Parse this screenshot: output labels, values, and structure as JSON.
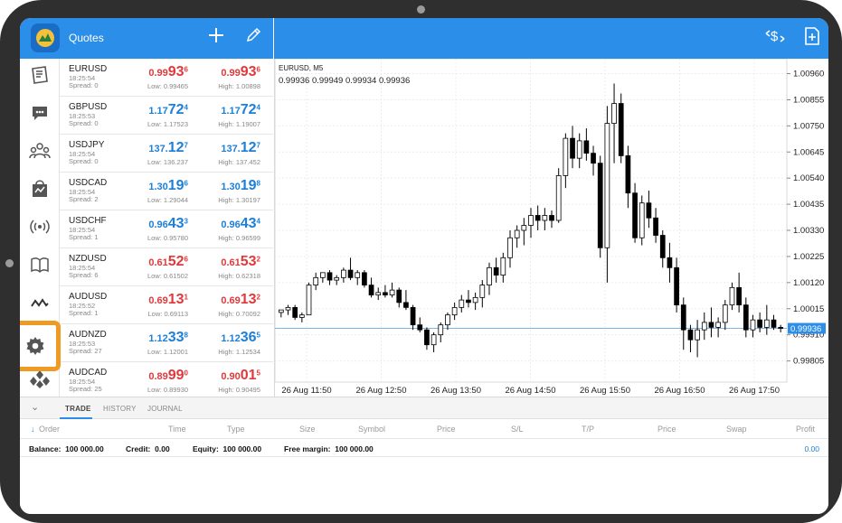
{
  "app": {
    "title": "Quotes"
  },
  "colors": {
    "accent": "#2b8ee8",
    "bid_down": "#e0393b",
    "bid_up": "#1c7fd8",
    "highlight": "#ef9a22"
  },
  "quotes": [
    {
      "symbol": "EURUSD",
      "time": "18:25:54",
      "spread": "Spread: 0",
      "dir": "red",
      "bid_pre": "0.99",
      "bid_big": "93",
      "bid_sup": "6",
      "ask_pre": "0.99",
      "ask_big": "93",
      "ask_sup": "6",
      "low": "Low: 0.99465",
      "high": "High: 1.00898"
    },
    {
      "symbol": "GBPUSD",
      "time": "18:25:53",
      "spread": "Spread: 0",
      "dir": "blue",
      "bid_pre": "1.17",
      "bid_big": "72",
      "bid_sup": "4",
      "ask_pre": "1.17",
      "ask_big": "72",
      "ask_sup": "4",
      "low": "Low: 1.17523",
      "high": "High: 1.19007"
    },
    {
      "symbol": "USDJPY",
      "time": "18:25:54",
      "spread": "Spread: 0",
      "dir": "blue",
      "bid_pre": "137.",
      "bid_big": "12",
      "bid_sup": "7",
      "ask_pre": "137.",
      "ask_big": "12",
      "ask_sup": "7",
      "low": "Low: 136.237",
      "high": "High: 137.452"
    },
    {
      "symbol": "USDCAD",
      "time": "18:25:54",
      "spread": "Spread: 2",
      "dir": "blue",
      "bid_pre": "1.30",
      "bid_big": "19",
      "bid_sup": "6",
      "ask_pre": "1.30",
      "ask_big": "19",
      "ask_sup": "8",
      "low": "Low: 1.29044",
      "high": "High: 1.30197"
    },
    {
      "symbol": "USDCHF",
      "time": "18:25:54",
      "spread": "Spread: 1",
      "dir": "blue",
      "bid_pre": "0.96",
      "bid_big": "43",
      "bid_sup": "3",
      "ask_pre": "0.96",
      "ask_big": "43",
      "ask_sup": "4",
      "low": "Low: 0.95780",
      "high": "High: 0.96599"
    },
    {
      "symbol": "NZDUSD",
      "time": "18:25:54",
      "spread": "Spread: 6",
      "dir": "red",
      "bid_pre": "0.61",
      "bid_big": "52",
      "bid_sup": "6",
      "ask_pre": "0.61",
      "ask_big": "53",
      "ask_sup": "2",
      "low": "Low: 0.61502",
      "high": "High: 0.62318"
    },
    {
      "symbol": "AUDUSD",
      "time": "18:25:52",
      "spread": "Spread: 1",
      "dir": "red",
      "bid_pre": "0.69",
      "bid_big": "13",
      "bid_sup": "1",
      "ask_pre": "0.69",
      "ask_big": "13",
      "ask_sup": "2",
      "low": "Low: 0.69113",
      "high": "High: 0.70092"
    },
    {
      "symbol": "AUDNZD",
      "time": "18:25:53",
      "spread": "Spread: 27",
      "dir": "blue",
      "bid_pre": "1.12",
      "bid_big": "33",
      "bid_sup": "8",
      "ask_pre": "1.12",
      "ask_big": "36",
      "ask_sup": "5",
      "low": "Low: 1.12001",
      "high": "High: 1.12534"
    },
    {
      "symbol": "AUDCAD",
      "time": "18:25:54",
      "spread": "Spread: 25",
      "dir": "red",
      "bid_pre": "0.89",
      "bid_big": "99",
      "bid_sup": "0",
      "ask_pre": "0.90",
      "ask_big": "01",
      "ask_sup": "5",
      "low": "Low: 0.89930",
      "high": "High: 0.90495"
    }
  ],
  "chart": {
    "symbol_tf": "EURUSD, M5",
    "ohlc": "0.99936 0.99949 0.99934 0.99936",
    "current_price_label": "0.99936"
  },
  "chart_data": {
    "type": "candlestick",
    "symbol": "EURUSD",
    "timeframe": "M5",
    "ylim": [
      0.9972,
      1.0102
    ],
    "y_ticks": [
      "1.00960",
      "1.00855",
      "1.00750",
      "1.00645",
      "1.00540",
      "1.00435",
      "1.00330",
      "1.00225",
      "1.00120",
      "1.00015",
      "0.99910",
      "0.99805"
    ],
    "x_ticks": [
      "26 Aug 11:50",
      "26 Aug 12:50",
      "26 Aug 13:50",
      "26 Aug 14:50",
      "26 Aug 15:50",
      "26 Aug 16:50",
      "26 Aug 17:50"
    ],
    "current_price": 0.99936,
    "grid": true,
    "candles": [
      [
        1.0,
        1.0001,
        0.9998,
        1.0001
      ],
      [
        1.0001,
        1.0003,
        0.9999,
        1.0002
      ],
      [
        1.0002,
        1.0003,
        0.9997,
        0.9998
      ],
      [
        0.9998,
        1.0,
        0.9996,
        0.9999
      ],
      [
        0.9999,
        1.0012,
        0.9999,
        1.0011
      ],
      [
        1.0011,
        1.0016,
        1.0009,
        1.0014
      ],
      [
        1.0014,
        1.0016,
        1.0012,
        1.0016
      ],
      [
        1.0016,
        1.0017,
        1.0011,
        1.0013
      ],
      [
        1.0013,
        1.0015,
        1.0011,
        1.0014
      ],
      [
        1.0014,
        1.0018,
        1.0012,
        1.0017
      ],
      [
        1.0017,
        1.0022,
        1.0013,
        1.0014
      ],
      [
        1.0014,
        1.0017,
        1.0011,
        1.0016
      ],
      [
        1.0016,
        1.0017,
        1.001,
        1.0011
      ],
      [
        1.0011,
        1.0014,
        1.0006,
        1.0007
      ],
      [
        1.0007,
        1.001,
        1.0005,
        1.0008
      ],
      [
        1.0008,
        1.0011,
        1.0006,
        1.0007
      ],
      [
        1.0007,
        1.0012,
        1.0006,
        1.0009
      ],
      [
        1.0009,
        1.001,
        1.0002,
        1.0004
      ],
      [
        1.0004,
        1.0009,
        1.0001,
        1.0002
      ],
      [
        1.0002,
        1.0003,
        0.9993,
        0.9995
      ],
      [
        0.9995,
        0.9998,
        0.9992,
        0.9993
      ],
      [
        0.9993,
        0.9994,
        0.9985,
        0.9987
      ],
      [
        0.9987,
        0.9992,
        0.9984,
        0.9991
      ],
      [
        0.9991,
        0.9996,
        0.9988,
        0.9995
      ],
      [
        0.9995,
        1.0,
        0.9993,
        0.9999
      ],
      [
        0.9999,
        1.0004,
        0.9997,
        1.0002
      ],
      [
        1.0002,
        1.0007,
        1.0,
        1.0005
      ],
      [
        1.0005,
        1.0009,
        1.0002,
        1.0004
      ],
      [
        1.0004,
        1.0008,
        1.0001,
        1.0006
      ],
      [
        1.0006,
        1.0013,
        1.0002,
        1.0011
      ],
      [
        1.0011,
        1.002,
        1.0007,
        1.0018
      ],
      [
        1.0018,
        1.0022,
        1.0012,
        1.0015
      ],
      [
        1.0015,
        1.0024,
        1.0012,
        1.0022
      ],
      [
        1.0022,
        1.0033,
        1.0018,
        1.003
      ],
      [
        1.003,
        1.0035,
        1.0026,
        1.0033
      ],
      [
        1.0033,
        1.0038,
        1.0027,
        1.0035
      ],
      [
        1.0035,
        1.0042,
        1.003,
        1.0039
      ],
      [
        1.0039,
        1.0043,
        1.0033,
        1.0037
      ],
      [
        1.0037,
        1.0042,
        1.0033,
        1.0039
      ],
      [
        1.0039,
        1.0041,
        1.0034,
        1.0037
      ],
      [
        1.0037,
        1.0058,
        1.0036,
        1.0055
      ],
      [
        1.0055,
        1.0072,
        1.005,
        1.007
      ],
      [
        1.007,
        1.0075,
        1.0058,
        1.0062
      ],
      [
        1.0062,
        1.0072,
        1.0058,
        1.0069
      ],
      [
        1.0069,
        1.0074,
        1.0061,
        1.0064
      ],
      [
        1.0064,
        1.0067,
        1.0055,
        1.006
      ],
      [
        1.006,
        1.0063,
        1.0022,
        1.0026
      ],
      [
        1.0026,
        1.0083,
        1.0012,
        1.0076
      ],
      [
        1.0076,
        1.0092,
        1.006,
        1.0084
      ],
      [
        1.0084,
        1.0088,
        1.006,
        1.0063
      ],
      [
        1.0063,
        1.0067,
        1.0042,
        1.0048
      ],
      [
        1.0048,
        1.0052,
        1.0028,
        1.003
      ],
      [
        1.003,
        1.0047,
        1.0027,
        1.0044
      ],
      [
        1.0044,
        1.0049,
        1.0034,
        1.0038
      ],
      [
        1.0038,
        1.0042,
        1.0028,
        1.0031
      ],
      [
        1.0031,
        1.0033,
        1.0018,
        1.0022
      ],
      [
        1.0022,
        1.0028,
        1.0012,
        1.0018
      ],
      [
        1.0018,
        1.0022,
        1.0,
        1.0003
      ],
      [
        1.0003,
        1.0006,
        0.9985,
        0.9993
      ],
      [
        0.9993,
        0.9995,
        0.9984,
        0.9989
      ],
      [
        0.9989,
        0.9997,
        0.9982,
        0.9993
      ],
      [
        0.9993,
        1.0,
        0.9989,
        0.9996
      ],
      [
        0.9996,
        1.0002,
        0.999,
        0.9994
      ],
      [
        0.9994,
        0.9998,
        0.999,
        0.9996
      ],
      [
        0.9996,
        1.0005,
        0.9993,
        1.0003
      ],
      [
        1.0003,
        1.0012,
        1.0001,
        1.001
      ],
      [
        1.001,
        1.0016,
        1.0,
        1.0003
      ],
      [
        1.0003,
        1.0006,
        0.999,
        0.9993
      ],
      [
        0.9993,
        0.9999,
        0.999,
        0.9997
      ],
      [
        0.9997,
        1.0,
        0.9992,
        0.9994
      ],
      [
        0.9994,
        1.0003,
        0.9991,
        0.9997
      ],
      [
        0.9997,
        0.9999,
        0.9993,
        0.9994
      ],
      [
        0.9994,
        0.9995,
        0.9992,
        0.99936
      ]
    ]
  },
  "bottom": {
    "tabs": [
      "TRADE",
      "HISTORY",
      "JOURNAL"
    ],
    "columns": [
      "Order",
      "Time",
      "Type",
      "Size",
      "Symbol",
      "Price",
      "S/L",
      "T/P",
      "Price",
      "Swap",
      "Profit"
    ],
    "balance_label": "Balance:",
    "balance_value": "100 000.00",
    "credit_label": "Credit:",
    "credit_value": "0.00",
    "equity_label": "Equity:",
    "equity_value": "100 000.00",
    "margin_label": "Free margin:",
    "margin_value": "100 000.00",
    "profit_value": "0.00"
  }
}
